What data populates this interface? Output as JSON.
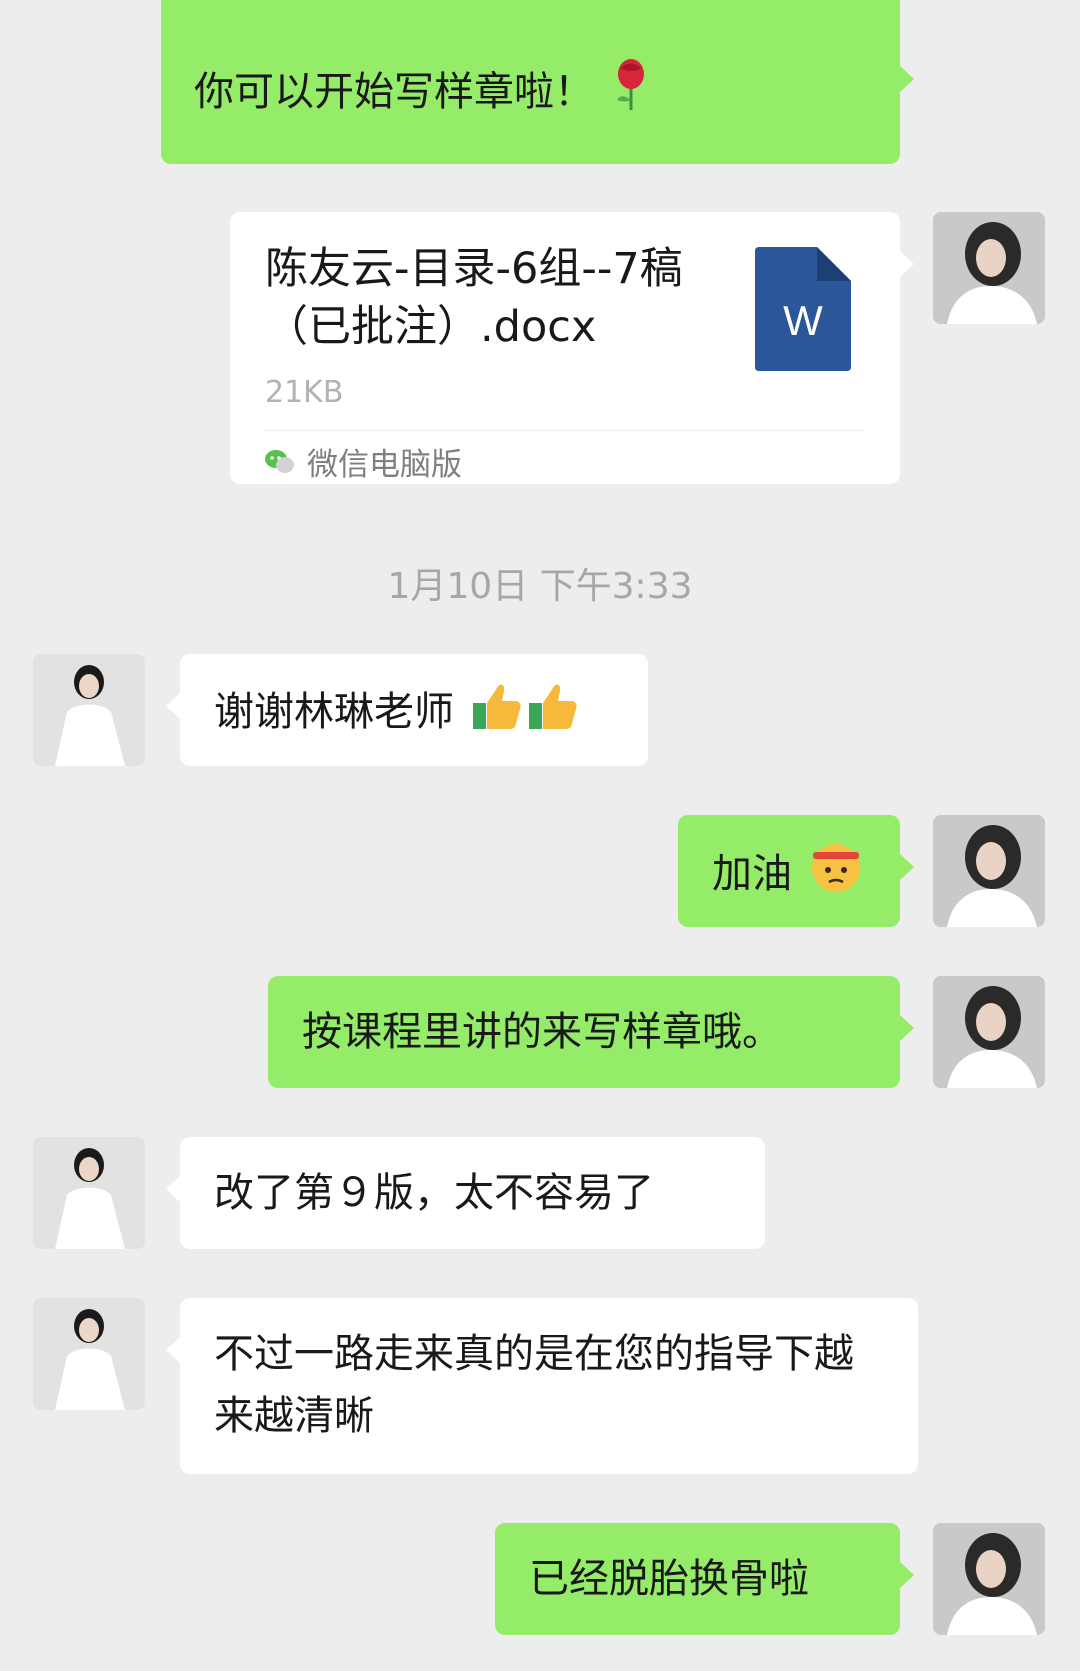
{
  "messages": {
    "m1": {
      "text": "你可以开始写样章啦！",
      "emoji": "rose"
    },
    "file": {
      "name": "陈友云-目录-6组--7稿 （已批注）.docx",
      "size": "21KB",
      "source": "微信电脑版",
      "badge": "W"
    },
    "timestamp": "1月10日 下午3:33",
    "m2": {
      "text": "谢谢林琳老师",
      "emoji": "thumbs-up x2"
    },
    "m3": {
      "text": "加油",
      "emoji": "fighting-face"
    },
    "m4": {
      "text": "按课程里讲的来写样章哦。"
    },
    "m5": {
      "text": "改了第９版，太不容易了"
    },
    "m6": {
      "text": "不过一路走来真的是在您的指导下越来越清晰"
    },
    "m7": {
      "text": "已经脱胎换骨啦"
    }
  },
  "colors": {
    "sent_bubble": "#95ec69",
    "received_bubble": "#ffffff",
    "background": "#ededed",
    "word_icon": "#2b579a"
  }
}
